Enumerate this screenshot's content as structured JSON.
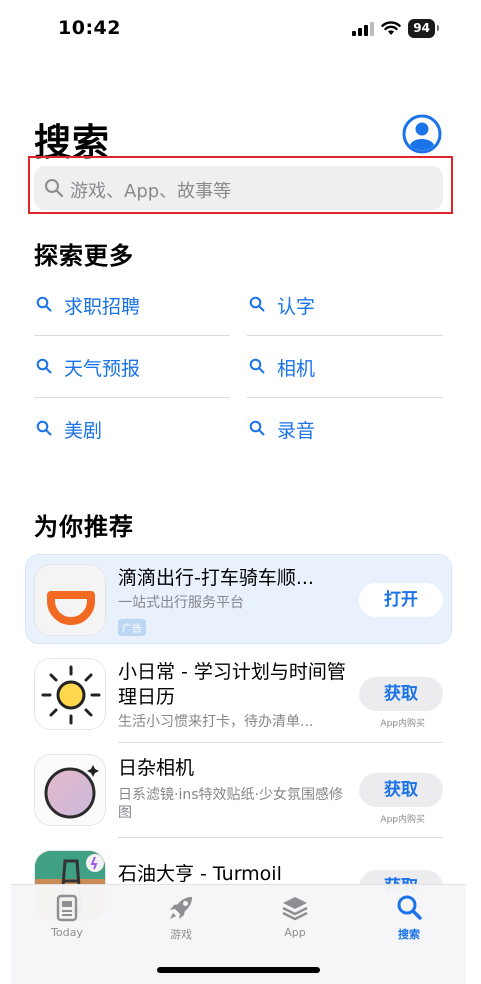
{
  "status_bar": {
    "time": "10:42",
    "battery": "94"
  },
  "header": {
    "title": "搜索"
  },
  "search": {
    "placeholder": "游戏、App、故事等"
  },
  "explore": {
    "title": "探索更多",
    "items": [
      {
        "label": "求职招聘"
      },
      {
        "label": "认字"
      },
      {
        "label": "天气预报"
      },
      {
        "label": "相机"
      },
      {
        "label": "美剧"
      },
      {
        "label": "录音"
      }
    ]
  },
  "recommend": {
    "title": "为你推荐",
    "apps": [
      {
        "name": "滴滴出行-打车骑车顺...",
        "subtitle": "一站式出行服务平台",
        "ad_label": "广告",
        "button": "打开"
      },
      {
        "name": "小日常 - 学习计划与时间管理日历",
        "subtitle": "生活小习惯来打卡，待办清单...",
        "button": "获取",
        "note": "App内购买"
      },
      {
        "name": "日杂相机",
        "subtitle": "日系滤镜·ins特效贴纸·少女氛围感修图",
        "button": "获取",
        "note": "App内购买"
      },
      {
        "name": "石油大亨 - Turmoil",
        "button": "获取"
      }
    ]
  },
  "tabs": [
    {
      "label": "Today",
      "icon": "today-icon"
    },
    {
      "label": "游戏",
      "icon": "rocket-icon"
    },
    {
      "label": "App",
      "icon": "app-stack-icon"
    },
    {
      "label": "搜索",
      "icon": "search-icon",
      "active": true
    }
  ],
  "colors": {
    "accent": "#1a73e8",
    "highlight_border": "#e0242b",
    "didi_orange": "#f26a21"
  }
}
